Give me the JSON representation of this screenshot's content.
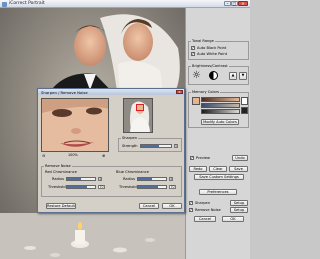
{
  "window": {
    "title": "iCorrect Portrait"
  },
  "right_panel": {
    "tonal_range": {
      "title": "Tonal Range",
      "auto_black_point": {
        "label": "Auto Black Point",
        "checked": true
      },
      "auto_white_point": {
        "label": "Auto White Point",
        "checked": true
      }
    },
    "brightness_contrast": {
      "title": "Brightness/Contrast"
    },
    "memory_colors": {
      "title": "Memory Colors",
      "modify_button": "Modify Auto Colors"
    },
    "preview": {
      "label": "Preview",
      "checked": true
    },
    "undo_button": "Undo",
    "redo_button": "Redo",
    "clear_button": "Clear",
    "save_button": "Save",
    "save_custom_button": "Save Custom Settings",
    "preferences_button": "Preferences",
    "sharpen": {
      "label": "Sharpen",
      "checked": true
    },
    "remove_noise": {
      "label": "Remove Noise",
      "checked": true
    },
    "setup_button": "Setup",
    "setup2_button": "Setup",
    "cancel_button": "Cancel",
    "ok_button": "OK"
  },
  "dialog": {
    "title": "Sharpen / Remove Noise",
    "zoom": "100%",
    "sharpen": {
      "title": "Sharpen",
      "strength_label": "Strength",
      "strength": "5",
      "strength_level": 0.6
    },
    "remove_noise": {
      "title": "Remove Noise",
      "red": {
        "title": "Red Chrominance",
        "radius_label": "Radius",
        "radius": "4",
        "radius_level": 0.5,
        "threshold_label": "Threshold",
        "threshold": "70",
        "threshold_level": 0.7
      },
      "blue": {
        "title": "Blue Chrominance",
        "radius_label": "Radius",
        "radius": "4",
        "radius_level": 0.5,
        "threshold_label": "Threshold",
        "threshold": "70",
        "threshold_level": 0.7
      }
    },
    "restore_button": "Restore Defaults",
    "cancel_button": "Cancel",
    "ok_button": "OK"
  }
}
